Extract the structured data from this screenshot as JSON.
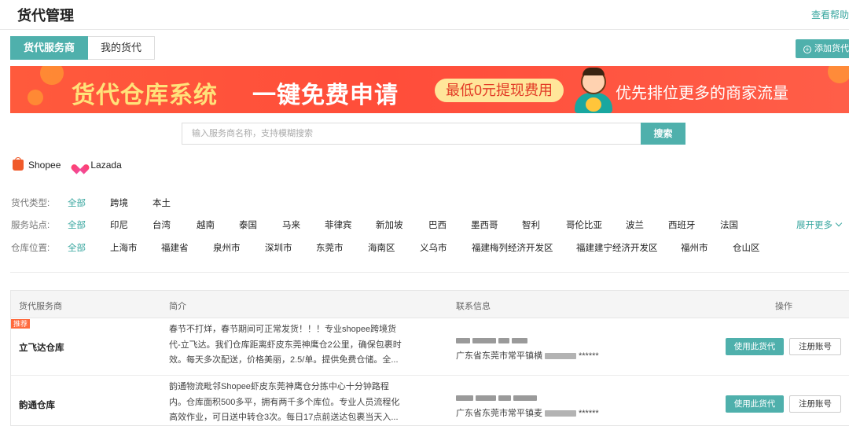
{
  "header": {
    "title": "货代管理",
    "help_link": "查看帮助"
  },
  "tabs": [
    {
      "label": "货代服务商",
      "active": true
    },
    {
      "label": "我的货代",
      "active": false
    }
  ],
  "add_button": "添加货代",
  "banner": {
    "headline1": "货代仓库系统",
    "headline2": "一键免费申请",
    "pill": "最低0元提现费用",
    "tagline": "优先排位更多的商家流量"
  },
  "search": {
    "placeholder": "输入服务商名称，支持模糊搜索",
    "button": "搜索"
  },
  "platforms": [
    {
      "label": "Shopee",
      "icon": "shopee-icon"
    },
    {
      "label": "Lazada",
      "icon": "lazada-icon"
    }
  ],
  "filters": {
    "type": {
      "label": "货代类型:",
      "options": [
        "全部",
        "跨境",
        "本土"
      ]
    },
    "site": {
      "label": "服务站点:",
      "options": [
        "全部",
        "印尼",
        "台湾",
        "越南",
        "泰国",
        "马来",
        "菲律宾",
        "新加坡",
        "巴西",
        "墨西哥",
        "智利",
        "哥伦比亚",
        "波兰",
        "西班牙",
        "法国"
      ],
      "expand": "展开更多"
    },
    "location": {
      "label": "仓库位置:",
      "options": [
        "全部",
        "上海市",
        "福建省",
        "泉州市",
        "深圳市",
        "东莞市",
        "海南区",
        "义乌市",
        "福建梅列经济开发区",
        "福建建宁经济开发区",
        "福州市",
        "仓山区"
      ]
    }
  },
  "table": {
    "columns": [
      "货代服务商",
      "简介",
      "联系信息",
      "操作"
    ],
    "rows": [
      {
        "badge": "推荐",
        "name": "立飞达仓库",
        "desc": "春节不打烊，春节期间可正常发货！！！专业shopee跨境货代-立飞达。我们仓库距离虾皮东莞神鹰仓2公里，确保包裹时效。每天多次配送，价格美丽，2.5/单。提供免费仓储。全...",
        "addr_prefix": "广东省东莞市常平镇横",
        "addr_suffix": "******",
        "use_button": "使用此货代",
        "register_button": "注册账号"
      },
      {
        "badge": "",
        "name": "韵通仓库",
        "desc": "韵通物流毗邻Shopee虾皮东莞神鹰仓分拣中心十分钟路程内。仓库面积500多平，拥有两千多个库位。专业人员流程化高效作业，可日送中转仓3次。每日17点前送达包裹当天入...",
        "addr_prefix": "广东省东莞市常平镇麦",
        "addr_suffix": "******",
        "use_button": "使用此货代",
        "register_button": "注册账号"
      }
    ]
  }
}
